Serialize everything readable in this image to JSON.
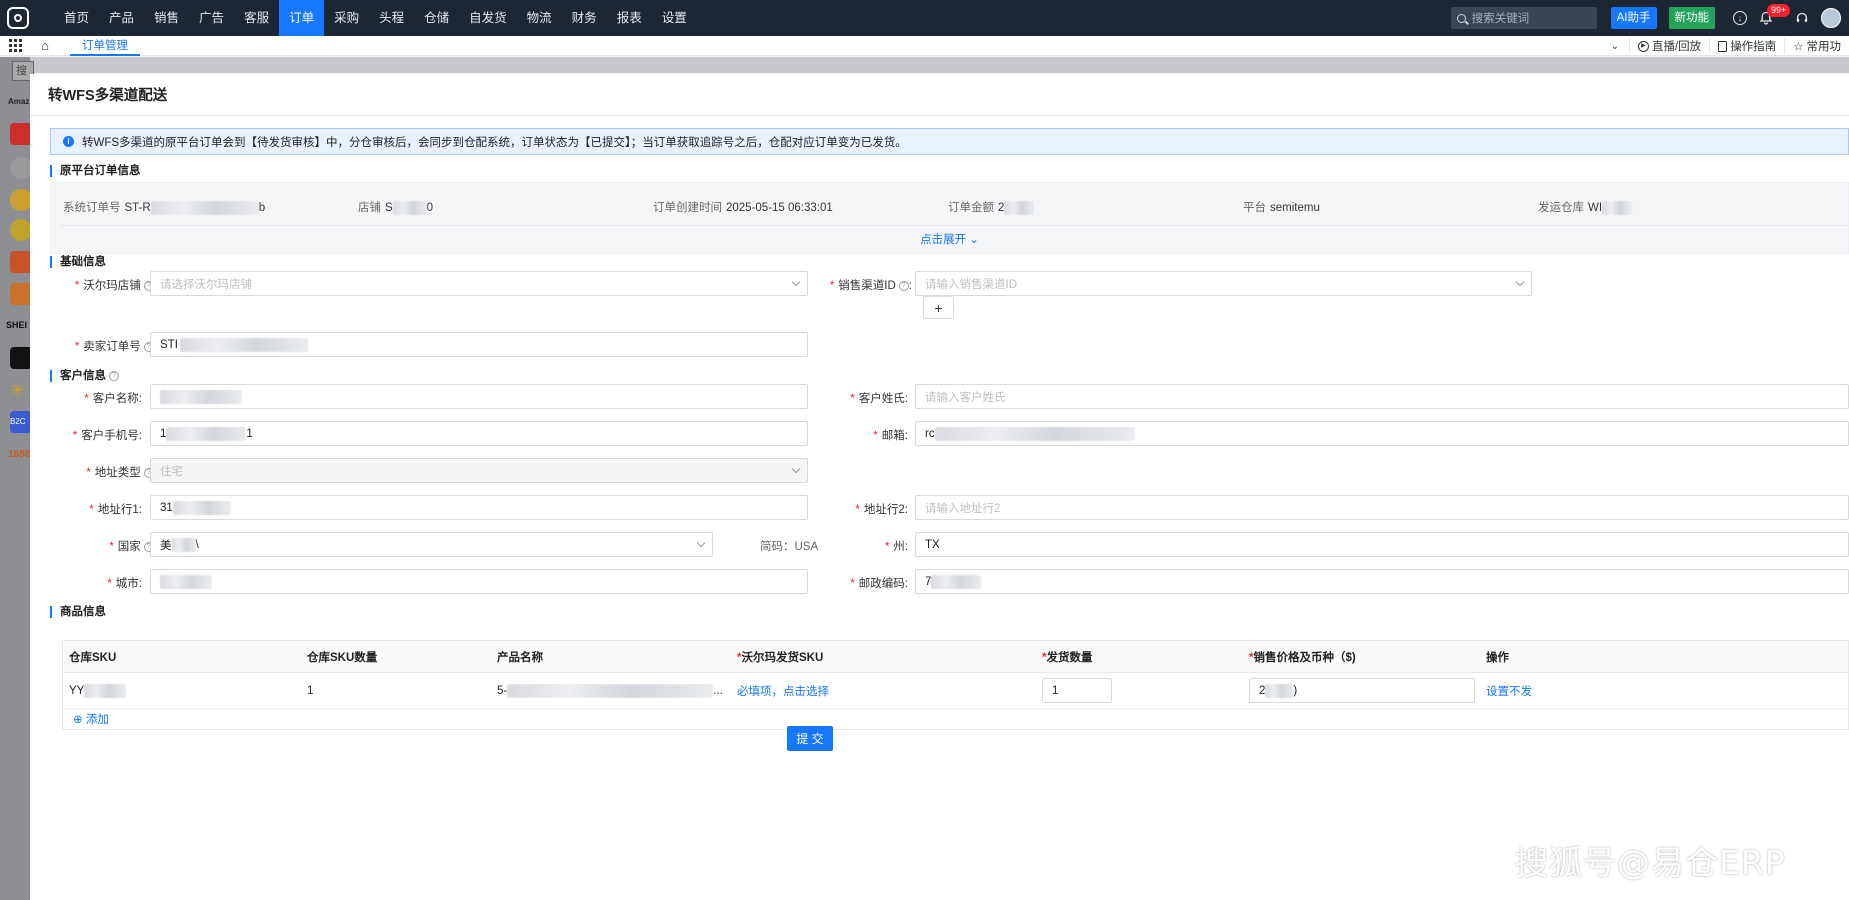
{
  "nav": {
    "menu": [
      "首页",
      "产品",
      "销售",
      "广告",
      "客服",
      "订单",
      "采购",
      "头程",
      "仓储",
      "自发货",
      "物流",
      "财务",
      "报表",
      "设置"
    ],
    "active_index": 5,
    "search_placeholder": "搜索关键词",
    "ai_label": "AI助手",
    "new_label": "新功能",
    "badge": "99+"
  },
  "tabbar": {
    "tab": "订单管理",
    "live_label": "直播/回放",
    "guide_label": "操作指南",
    "common_label": "常用功"
  },
  "background": {
    "search_stub": "搜",
    "amazon_text": "Amaz",
    "shein_text": "SHEI",
    "b2c_text": "B2C",
    "c1688_text": "1688"
  },
  "drawer": {
    "title": "转WFS多渠道配送",
    "alert": "转WFS多渠道的原平台订单会到【待发货审核】中，分仓审核后，会同步到仓配系统，订单状态为【已提交】；当订单获取追踪号之后，仓配对应订单变为已发货。",
    "sections": {
      "original": "原平台订单信息",
      "basic": "基础信息",
      "customer": "客户信息",
      "product": "商品信息"
    },
    "original": {
      "order_no_label": "系统订单号",
      "order_no_value": "ST-R",
      "order_no_tail": "b",
      "store_label": "店铺",
      "store_value": "S",
      "store_tail": "0",
      "created_label": "订单创建时间",
      "created_value": "2025-05-15 06:33:01",
      "amount_label": "订单金额",
      "amount_value": "2",
      "platform_label": "平台",
      "platform_value": "semitemu",
      "warehouse_label": "发运仓库",
      "warehouse_value": "WI",
      "expand": "点击展开"
    },
    "basic": {
      "store_label": "沃尔玛店铺",
      "store_placeholder": "请选择沃尔玛店铺",
      "channel_label": "销售渠道ID",
      "channel_placeholder": "请输入销售渠道ID",
      "plus": "+",
      "seller_order_label": "卖家订单号",
      "seller_order_value": "STI"
    },
    "customer": {
      "name_label": "客户名称:",
      "name_value": "",
      "surname_label": "客户姓氏:",
      "surname_placeholder": "请输入客户姓氏",
      "phone_label": "客户手机号:",
      "phone_value": "1",
      "phone_tail": "1",
      "email_label": "邮箱:",
      "email_value": "rc",
      "addr_type_label": "地址类型",
      "addr_type_value": "住宅",
      "addr1_label": "地址行1:",
      "addr1_value": "31",
      "addr2_label": "地址行2:",
      "addr2_placeholder": "请输入地址行2",
      "country_label": "国家",
      "country_value": "美",
      "country_tail": "\\",
      "abbr_label": "简码：USA",
      "state_label": "州:",
      "state_value": "TX",
      "city_label": "城市:",
      "city_value": "",
      "zip_label": "邮政编码:",
      "zip_value": "7"
    },
    "product_table": {
      "headers": [
        "仓库SKU",
        "仓库SKU数量",
        "产品名称",
        "沃尔玛发货SKU",
        "发货数量",
        "销售价格及币种（$)",
        "操作"
      ],
      "required_flags": [
        false,
        false,
        false,
        true,
        true,
        true,
        false
      ],
      "row": {
        "sku": "YY",
        "qty": "1",
        "name": "5-",
        "wfs_sku": "必填项，点击选择",
        "ship_qty": "1",
        "price": "2",
        "price_tail": ")",
        "action": "设置不发"
      },
      "add_label": "⊕ 添加"
    },
    "submit": "提 交"
  },
  "watermark": "搜狐号@易仓ERP",
  "colors": {
    "primary": "#1677ff",
    "nav_bg": "#1d2633",
    "success": "#22a45d",
    "required": "#f5222d"
  }
}
